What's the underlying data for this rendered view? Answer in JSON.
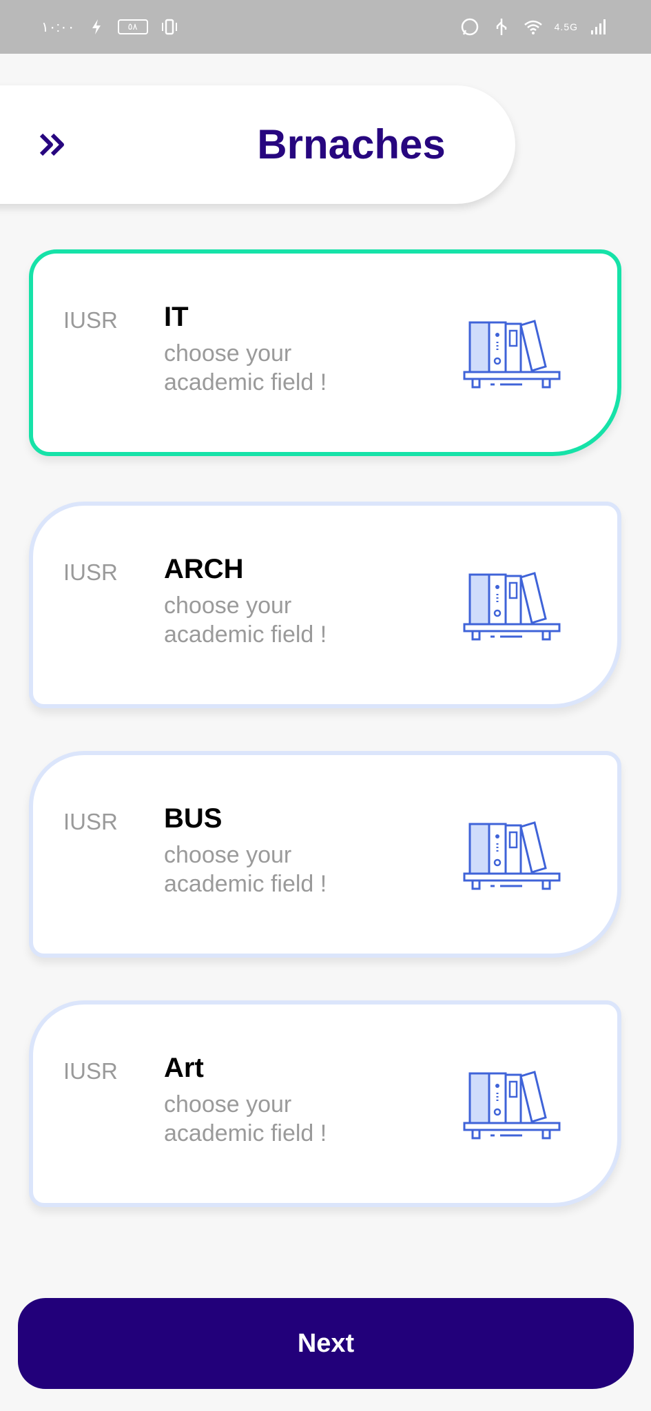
{
  "status_bar": {
    "time": "١٠:٠٠",
    "battery": "٥٨",
    "network": "4.5G"
  },
  "header": {
    "title": "Brnaches",
    "back_icon": "double-chevron-right-icon"
  },
  "cards": [
    {
      "tag": "IUSR",
      "name": "IT",
      "subtitle": "choose your academic field !",
      "selected": true
    },
    {
      "tag": "IUSR",
      "name": "ARCH",
      "subtitle": "choose your academic field !",
      "selected": false
    },
    {
      "tag": "IUSR",
      "name": "BUS",
      "subtitle": "choose your academic field !",
      "selected": false
    },
    {
      "tag": "IUSR",
      "name": "Art",
      "subtitle": "choose your academic field !",
      "selected": false
    }
  ],
  "next_button": {
    "label": "Next"
  },
  "colors": {
    "accent": "#27067f",
    "button": "#22007a",
    "selected_border": "#16e2a8",
    "card_border": "#dbe5fb",
    "icon": "#3f63d8"
  }
}
